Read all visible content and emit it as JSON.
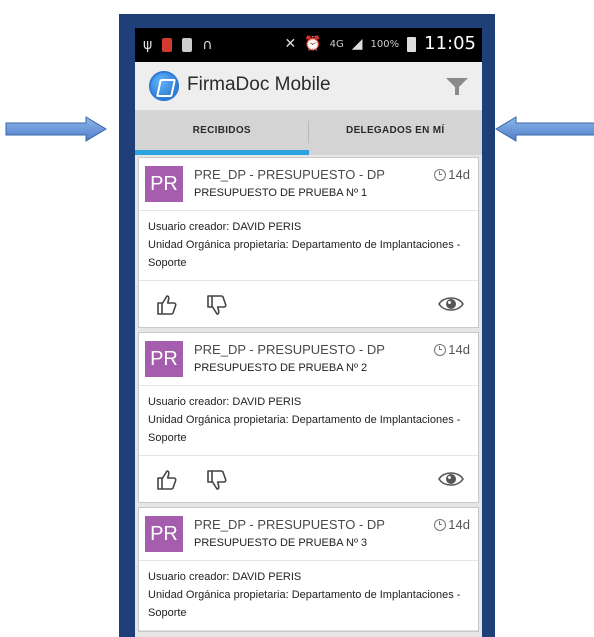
{
  "status_bar": {
    "time": "11:05",
    "battery_pct": "100%",
    "network": "4G",
    "icons": [
      "usb-icon",
      "app-icon-red",
      "app-icon-white",
      "headphones-icon",
      "mute-icon",
      "alarm-icon",
      "network-icon",
      "signal-icon",
      "battery-icon"
    ]
  },
  "app_bar": {
    "title": "FirmaDoc Mobile",
    "logo_icon": "firmadoc-logo-icon",
    "filter_icon": "filter-icon"
  },
  "tabs": [
    {
      "label": "RECIBIDOS",
      "active": true
    },
    {
      "label": "DELEGADOS EN MÍ",
      "active": false
    }
  ],
  "colors": {
    "accent": "#2aa3e0",
    "badge": "#a55dae",
    "frame": "#1f3f78",
    "arrow": "#5b8fd6"
  },
  "cards": [
    {
      "badge": "PR",
      "title": "PRE_DP - PRESUPUESTO - DP",
      "subtitle": "PRESUPUESTO DE PRUEBA Nº 1",
      "age": "14d",
      "creator": "Usuario creador: DAVID PERIS",
      "unit": "Unidad Orgánica propietaria: Departamento de Implantaciones - Soporte"
    },
    {
      "badge": "PR",
      "title": "PRE_DP - PRESUPUESTO - DP",
      "subtitle": "PRESUPUESTO DE PRUEBA Nº 2",
      "age": "14d",
      "creator": "Usuario creador: DAVID PERIS",
      "unit": "Unidad Orgánica propietaria: Departamento de Implantaciones - Soporte"
    },
    {
      "badge": "PR",
      "title": "PRE_DP - PRESUPUESTO - DP",
      "subtitle": "PRESUPUESTO DE PRUEBA Nº 3",
      "age": "14d",
      "creator": "Usuario creador: DAVID PERIS",
      "unit": "Unidad Orgánica propietaria: Departamento de Implantaciones - Soporte"
    }
  ]
}
